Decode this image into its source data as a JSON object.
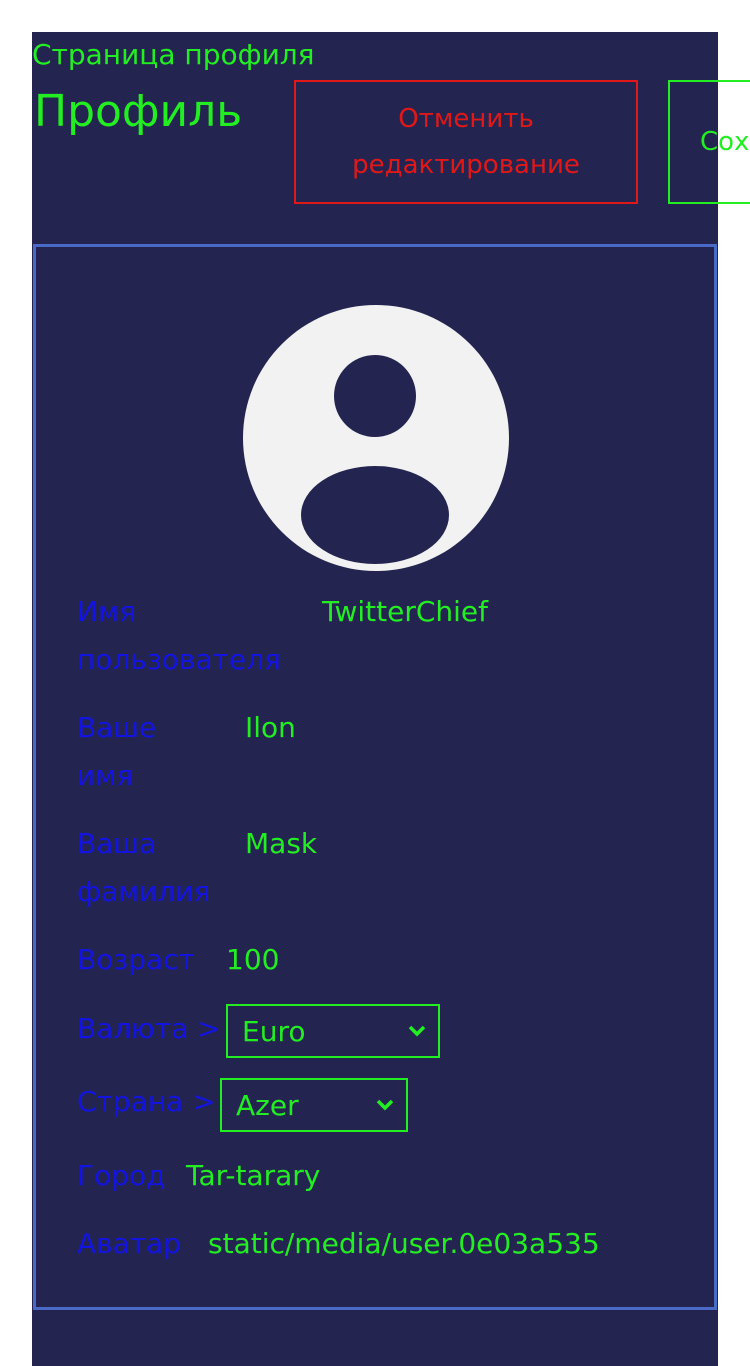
{
  "header": {
    "page_label": "Страница профиля",
    "title": "Профиль",
    "cancel_label": "Отменить редактирование",
    "save_label": "Сохранить"
  },
  "profile": {
    "avatar_icon": "user-avatar-icon",
    "fields": {
      "username": {
        "label": "Имя пользователя",
        "value": "TwitterChief"
      },
      "first_name": {
        "label": "Ваше имя",
        "value": "Ilon"
      },
      "last_name": {
        "label": "Ваша фамилия",
        "value": "Mask"
      },
      "age": {
        "label": "Возраст",
        "value": "100"
      },
      "currency": {
        "label": "Валюта >",
        "value": "Euro"
      },
      "country": {
        "label": "Страна >",
        "value": "Azer"
      },
      "city": {
        "label": "Город",
        "value": "Tar-tarary"
      },
      "avatar": {
        "label": "Аватар",
        "value": "static/media/user.0e03a535"
      }
    }
  },
  "colors": {
    "background": "#232550",
    "accent": "#22ee22",
    "danger": "#e01818",
    "label": "#1414e0",
    "border": "#4a6ac8"
  }
}
